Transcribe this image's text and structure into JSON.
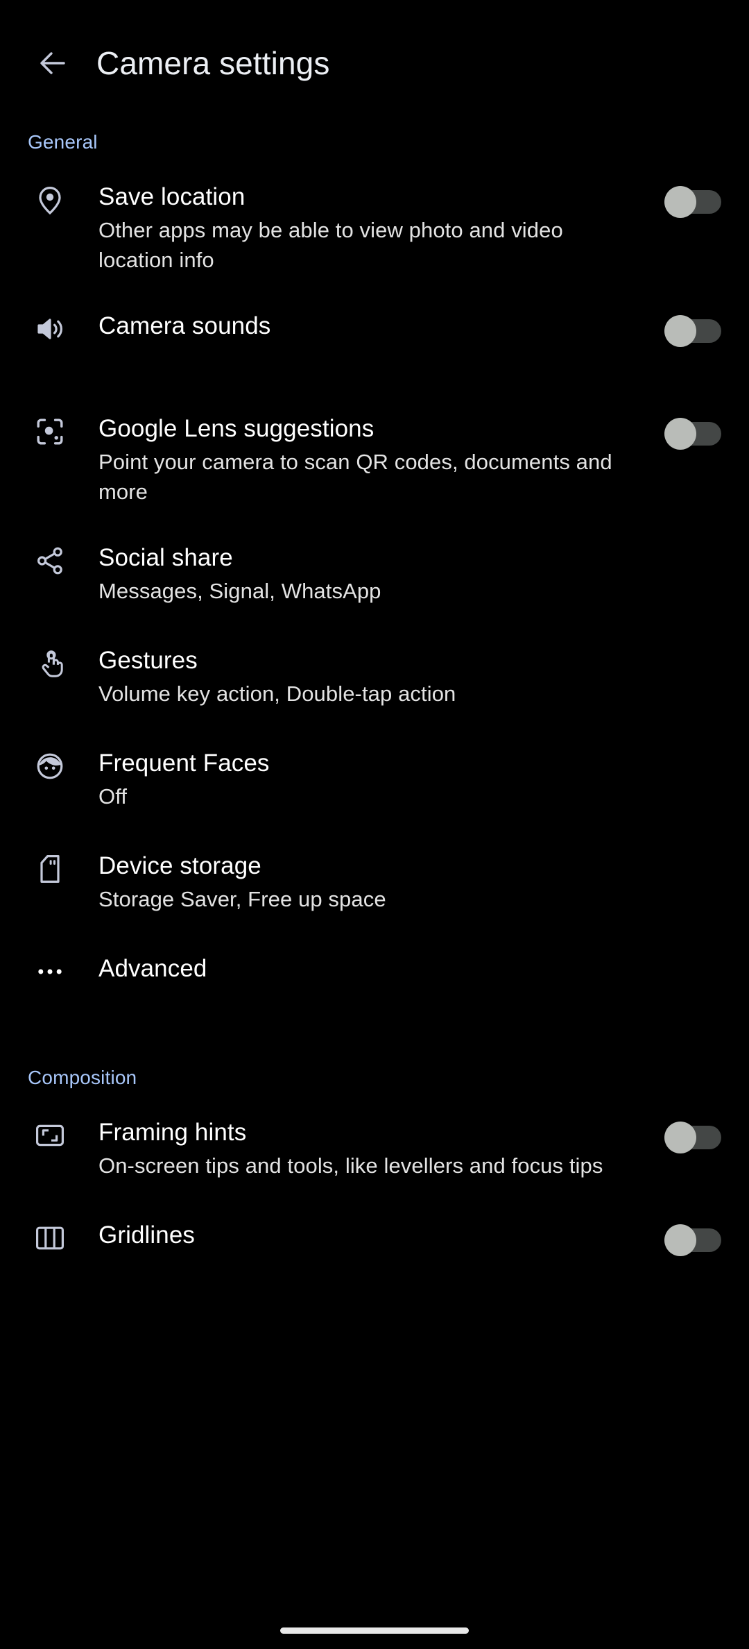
{
  "appbar": {
    "back_icon": "arrow-back-icon",
    "title": "Camera settings"
  },
  "colors": {
    "background": "#000000",
    "accent": "#a8c7fa",
    "title_text": "#ffffff",
    "summary_text": "#e3e3e3",
    "icon": "#c4c9da",
    "switch_track_off": "#444746",
    "switch_thumb_off": "#b9bcb8",
    "nav_pill": "#e8e8e8"
  },
  "sections": [
    {
      "id": "general",
      "header": "General",
      "items": [
        {
          "id": "save-location",
          "icon": "location-pin-icon",
          "title": "Save location",
          "summary": "Other apps may be able to view photo and video location info",
          "control": "switch",
          "switch_state": "off"
        },
        {
          "id": "camera-sounds",
          "icon": "volume-up-icon",
          "title": "Camera sounds",
          "summary": "",
          "control": "switch",
          "switch_state": "off"
        },
        {
          "id": "google-lens-suggestions",
          "icon": "google-lens-icon",
          "title": "Google Lens suggestions",
          "summary": "Point your camera to scan QR codes, documents and more",
          "control": "switch",
          "switch_state": "off"
        },
        {
          "id": "social-share",
          "icon": "share-icon",
          "title": "Social share",
          "summary": "Messages, Signal, WhatsApp",
          "control": "none"
        },
        {
          "id": "gestures",
          "icon": "tap-gesture-icon",
          "title": "Gestures",
          "summary": "Volume key action, Double-tap action",
          "control": "none"
        },
        {
          "id": "frequent-faces",
          "icon": "face-icon",
          "title": "Frequent Faces",
          "summary": "Off",
          "control": "none"
        },
        {
          "id": "device-storage",
          "icon": "sd-card-icon",
          "title": "Device storage",
          "summary": "Storage Saver, Free up space",
          "control": "none"
        },
        {
          "id": "advanced",
          "icon": "more-horizontal-icon",
          "title": "Advanced",
          "summary": "",
          "control": "none"
        }
      ]
    },
    {
      "id": "composition",
      "header": "Composition",
      "items": [
        {
          "id": "framing-hints",
          "icon": "framing-crop-icon",
          "title": "Framing hints",
          "summary": "On-screen tips and tools, like levellers and focus tips",
          "control": "switch",
          "switch_state": "off"
        },
        {
          "id": "gridlines",
          "icon": "grid-columns-icon",
          "title": "Gridlines",
          "summary": "",
          "control": "switch",
          "switch_state": "off"
        }
      ]
    }
  ],
  "navigation": {
    "home_pill": "home-indicator"
  }
}
